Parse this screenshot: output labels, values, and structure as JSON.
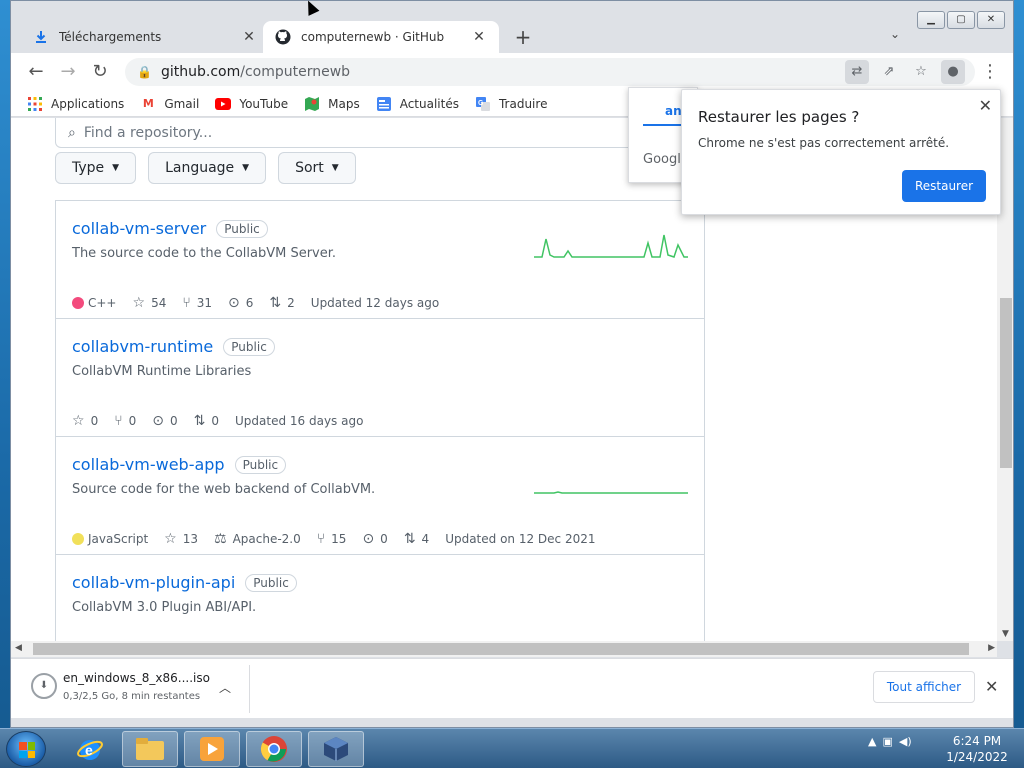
{
  "tabs": [
    {
      "title": "Téléchargements",
      "icon": "download-icon"
    },
    {
      "title": "computernewb · GitHub",
      "icon": "github-icon"
    }
  ],
  "address": {
    "host": "github.com",
    "path": "/computernewb"
  },
  "bookmarks": [
    {
      "label": "Applications",
      "icon": "apps-grid-icon"
    },
    {
      "label": "Gmail",
      "icon": "gmail-icon"
    },
    {
      "label": "YouTube",
      "icon": "youtube-icon"
    },
    {
      "label": "Maps",
      "icon": "maps-icon"
    },
    {
      "label": "Actualités",
      "icon": "news-icon"
    },
    {
      "label": "Traduire",
      "icon": "translate-icon"
    }
  ],
  "search": {
    "placeholder": "Find a repository..."
  },
  "filters": [
    "Type",
    "Language",
    "Sort"
  ],
  "repos": [
    {
      "name": "collab-vm-server",
      "visibility": "Public",
      "description": "The source code to the CollabVM Server.",
      "language": "C++",
      "language_color": "#f34b7d",
      "stars": "54",
      "forks": "31",
      "issues": "6",
      "prs": "2",
      "updated": "Updated 12 days ago"
    },
    {
      "name": "collabvm-runtime",
      "visibility": "Public",
      "description": "CollabVM Runtime Libraries",
      "stars": "0",
      "forks": "0",
      "issues": "0",
      "prs": "0",
      "updated": "Updated 16 days ago"
    },
    {
      "name": "collab-vm-web-app",
      "visibility": "Public",
      "description": "Source code for the web backend of CollabVM.",
      "language": "JavaScript",
      "language_color": "#f1e05a",
      "stars": "13",
      "license": "Apache-2.0",
      "forks": "15",
      "issues": "0",
      "prs": "4",
      "updated": "Updated on 12 Dec 2021"
    },
    {
      "name": "collab-vm-plugin-api",
      "visibility": "Public",
      "description": "CollabVM 3.0 Plugin ABI/API."
    }
  ],
  "translate": {
    "lang": "ang",
    "brand": "Google"
  },
  "restore": {
    "title": "Restaurer les pages ?",
    "text": "Chrome ne s'est pas correctement arrêté.",
    "button": "Restaurer"
  },
  "download": {
    "filename": "en_windows_8_x86....iso",
    "status": "0,3/2,5 Go, 8 min restantes",
    "show_all": "Tout afficher"
  },
  "clock": {
    "time": "6:24 PM",
    "date": "1/24/2022"
  }
}
